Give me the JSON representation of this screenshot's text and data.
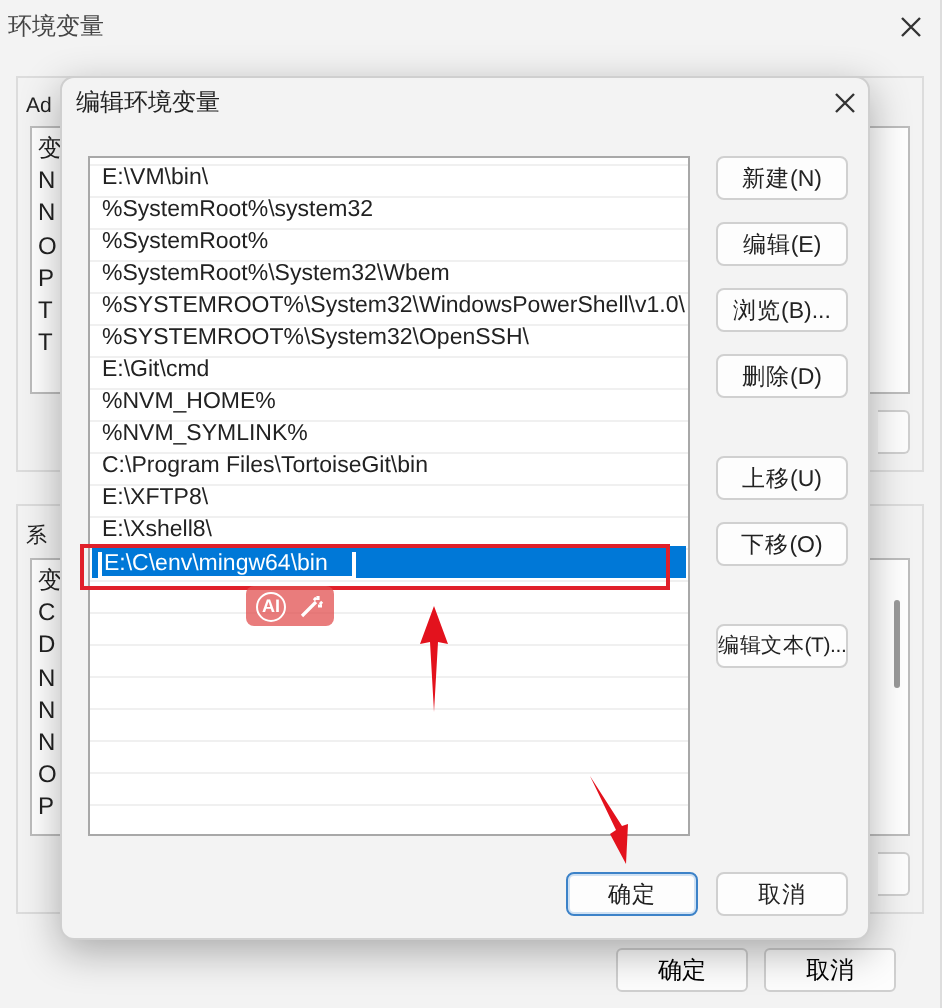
{
  "background_window": {
    "title": "环境变量",
    "user_section_label": "Ad",
    "user_variables": [
      "变",
      "N",
      "N",
      "O",
      "P",
      "T",
      "T"
    ],
    "system_section_label": "系",
    "system_variables": [
      "变",
      "C",
      "D",
      "N",
      "N",
      "N",
      "O",
      "P"
    ],
    "buttons": [
      {
        "label": "确定"
      },
      {
        "label": "取消"
      }
    ]
  },
  "dialog": {
    "title": "编辑环境变量",
    "paths": [
      {
        "text": "E:\\VM\\bin\\",
        "selected": false
      },
      {
        "text": "%SystemRoot%\\system32",
        "selected": false
      },
      {
        "text": "%SystemRoot%",
        "selected": false
      },
      {
        "text": "%SystemRoot%\\System32\\Wbem",
        "selected": false
      },
      {
        "text": "%SYSTEMROOT%\\System32\\WindowsPowerShell\\v1.0\\",
        "selected": false
      },
      {
        "text": "%SYSTEMROOT%\\System32\\OpenSSH\\",
        "selected": false
      },
      {
        "text": "E:\\Git\\cmd",
        "selected": false
      },
      {
        "text": "%NVM_HOME%",
        "selected": false
      },
      {
        "text": "%NVM_SYMLINK%",
        "selected": false
      },
      {
        "text": "C:\\Program Files\\TortoiseGit\\bin",
        "selected": false
      },
      {
        "text": "E:\\XFTP8\\",
        "selected": false
      },
      {
        "text": "E:\\Xshell8\\",
        "selected": false
      },
      {
        "text": "E:\\C\\env\\mingw64\\bin",
        "selected": true
      }
    ],
    "side_button_groups": [
      [
        {
          "label": "新建(N)"
        },
        {
          "label": "编辑(E)"
        },
        {
          "label": "浏览(B)..."
        },
        {
          "label": "删除(D)"
        }
      ],
      [
        {
          "label": "上移(U)"
        },
        {
          "label": "下移(O)"
        }
      ],
      [
        {
          "label": "编辑文本(T)..."
        }
      ]
    ],
    "buttons": [
      {
        "label": "确定",
        "default": true
      },
      {
        "label": "取消",
        "default": false
      }
    ]
  },
  "ai_toolbar": {
    "label": "AI"
  }
}
